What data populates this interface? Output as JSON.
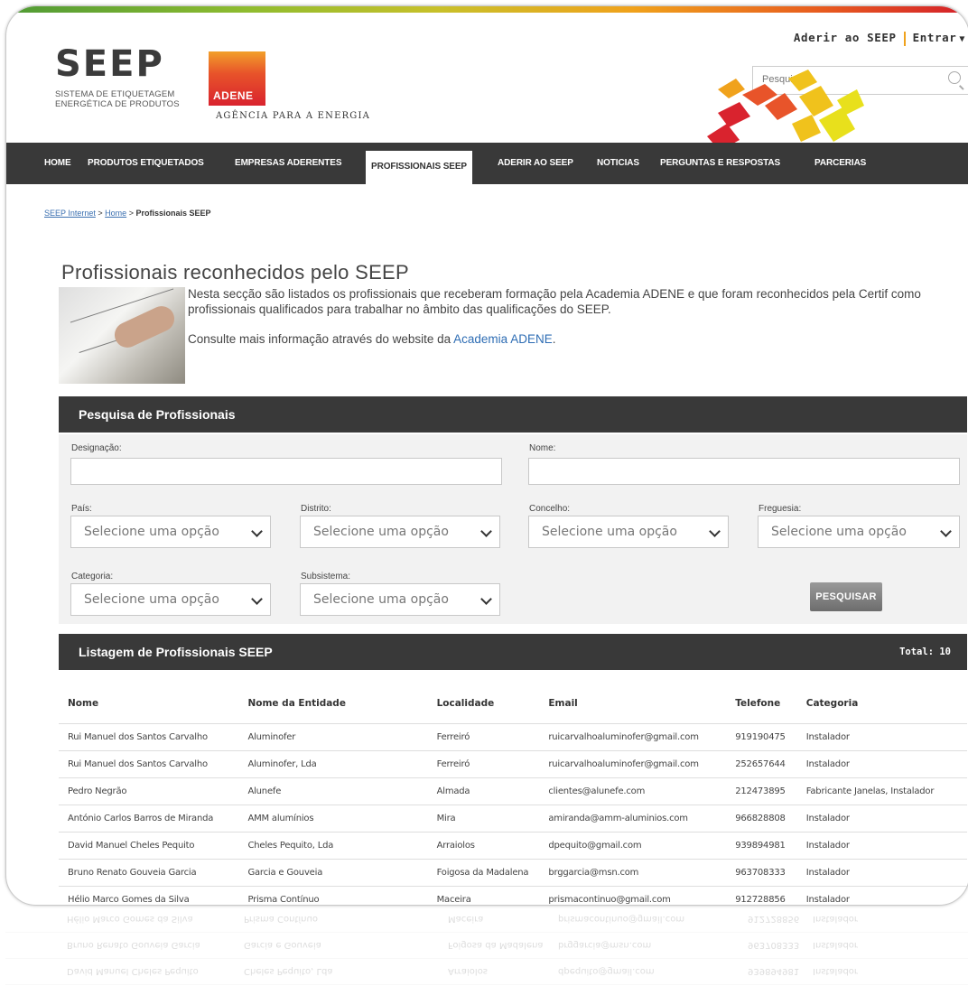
{
  "header": {
    "logo_seep": "SEEP",
    "logo_seep_sub1": "SISTEMA DE ETIQUETAGEM",
    "logo_seep_sub2": "ENERGÉTICA DE PRODUTOS",
    "logo_adene": "ADENE",
    "logo_adene_tag": "AGÊNCIA PARA A ENERGIA",
    "link_aderir": "Aderir ao SEEP",
    "link_entrar": "Entrar",
    "search_placeholder": "Pesquisar..."
  },
  "nav": [
    "HOME",
    "PRODUTOS ETIQUETADOS",
    "EMPRESAS ADERENTES",
    "PROFISSIONAIS SEEP",
    "ADERIR AO SEEP",
    "NOTICIAS",
    "PERGUNTAS E RESPOSTAS",
    "PARCERIAS"
  ],
  "breadcrumb": {
    "b1": "SEEP Internet",
    "sep": ">",
    "b2": "Home",
    "b3": "Profissionais SEEP"
  },
  "intro": {
    "title": "Profissionais reconhecidos pelo SEEP",
    "p1": "Nesta secção são listados os profissionais que receberam formação pela Academia ADENE e que foram reconhecidos pela Certif como profissionais qualificados para trabalhar no âmbito das qualificações do SEEP.",
    "p2_prefix": "Consulte mais informação através do website da ",
    "p2_link": "Academia ADENE",
    "p2_suffix": "."
  },
  "search_panel": {
    "title": "Pesquisa de Profissionais",
    "designacao_label": "Designação:",
    "nome_label": "Nome:",
    "pais_label": "País:",
    "distrito_label": "Distrito:",
    "concelho_label": "Concelho:",
    "freguesia_label": "Freguesia:",
    "categoria_label": "Categoria:",
    "subsistema_label": "Subsistema:",
    "select_default": "Selecione uma opção",
    "button": "PESQUISAR"
  },
  "listing": {
    "title": "Listagem de Profissionais SEEP",
    "total": "Total: 10",
    "columns": [
      "Nome",
      "Nome da Entidade",
      "Localidade",
      "Email",
      "Telefone",
      "Categoria"
    ],
    "rows": [
      [
        "Rui Manuel dos Santos Carvalho",
        "Aluminofer",
        "Ferreiró",
        "ruicarvalhoaluminofer@gmail.com",
        "919190475",
        "Instalador"
      ],
      [
        "Rui Manuel dos Santos Carvalho",
        "Aluminofer, Lda",
        "Ferreiró",
        "ruicarvalhoaluminofer@gmail.com",
        "252657644",
        "Instalador"
      ],
      [
        "Pedro Negrão",
        "Alunefe",
        "Almada",
        "clientes@alunefe.com",
        "212473895",
        "Fabricante Janelas, Instalador"
      ],
      [
        "António Carlos Barros de Miranda",
        "AMM alumínios",
        "Mira",
        "amiranda@amm-aluminios.com",
        "966828808",
        "Instalador"
      ],
      [
        "David Manuel Cheles Pequito",
        "Cheles Pequito, Lda",
        "Arraiolos",
        "dpequito@gmail.com",
        "939894981",
        "Instalador"
      ],
      [
        "Bruno Renato Gouveia Garcia",
        "Garcia e Gouveia",
        "Foigosa da Madalena",
        "brggarcia@msn.com",
        "963708333",
        "Instalador"
      ],
      [
        "Hélio Marco Gomes da Silva",
        "Prisma Contínuo",
        "Maceira",
        "prismacontinuo@gmail.com",
        "912728856",
        "Instalador"
      ]
    ]
  },
  "colors": {
    "nav_bg": "#393939",
    "accent_orange": "#f0a21c",
    "accent_red": "#e03b26",
    "link_blue": "#2e6db4"
  }
}
